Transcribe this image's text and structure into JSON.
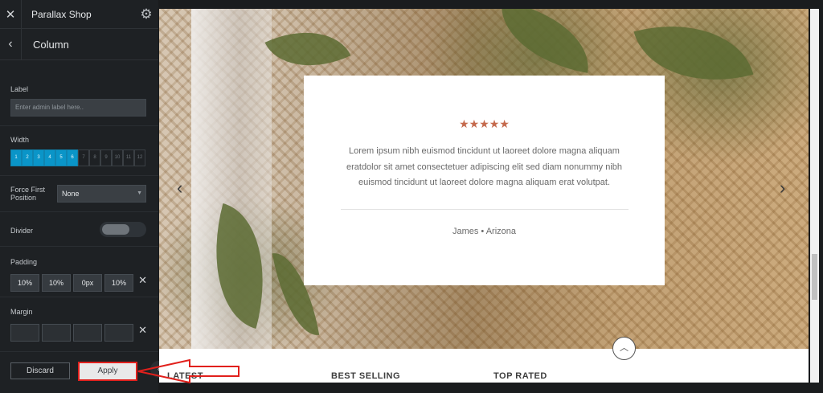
{
  "sidebar": {
    "header": {
      "title": "Parallax Shop"
    },
    "section": {
      "title": "Column"
    },
    "label_field": {
      "label": "Label",
      "placeholder": "Enter admin label here.."
    },
    "width_field": {
      "label": "Width",
      "cells": [
        "1",
        "2",
        "3",
        "4",
        "5",
        "6",
        "7",
        "8",
        "9",
        "10",
        "11",
        "12"
      ],
      "selected": 6
    },
    "force_first": {
      "label_line1": "Force First",
      "label_line2": "Position",
      "value": "None"
    },
    "divider": {
      "label": "Divider",
      "enabled": false
    },
    "padding": {
      "label": "Padding",
      "values": [
        "10%",
        "10%",
        "0px",
        "10%"
      ]
    },
    "margin": {
      "label": "Margin",
      "values": [
        "",
        "",
        "",
        ""
      ]
    },
    "actions": {
      "discard": "Discard",
      "apply": "Apply"
    }
  },
  "preview": {
    "testimonial": {
      "stars": "★★★★★",
      "rating": 5,
      "quote": "Lorem ipsum nibh euismod tincidunt ut laoreet dolore magna aliquam eratdolor sit amet consectetuer adipiscing elit sed diam nonummy nibh euismod tincidunt ut laoreet dolore magna aliquam erat volutpat.",
      "author": "James • Arizona"
    },
    "columns": [
      "LATEST",
      "BEST SELLING",
      "TOP RATED"
    ]
  },
  "colors": {
    "accent": "#0a95c8",
    "star": "#c56a4d",
    "highlight": "#e1201c"
  }
}
